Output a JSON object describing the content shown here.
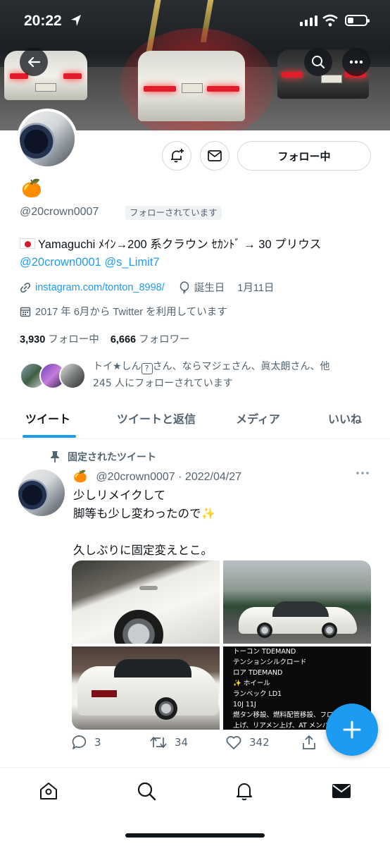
{
  "status_bar": {
    "time": "20:22"
  },
  "profile": {
    "name_emoji": "🍊",
    "handle": "@20crown0007",
    "follows_you_label": "フォローされています",
    "follow_button_label": "フォロー中",
    "bio_line1": "Yamaguchi ﾒｲﾝ→200 系クラウン ｾｶﾝﾄﾞ → 30 プリウス",
    "bio_mention1": "@20crown0001",
    "bio_mention2": "@s_Limit7",
    "website": "instagram.com/tonton_8998/",
    "birthday_label": "誕生日",
    "birthday": "1月11日",
    "joined": "2017 年 6月から Twitter を利用しています",
    "following_count": "3,930",
    "following_label": "フォロー中",
    "followers_count": "6,666",
    "followers_label": "フォロワー",
    "mutual_text_a": "トイ★しん",
    "mutual_text_b": "さん、ならマジェさん、眞太朗さん、他",
    "mutual_text_c": "245 人にフォローされています"
  },
  "tabs": [
    {
      "label": "ツイート"
    },
    {
      "label": "ツイートと返信"
    },
    {
      "label": "メディア"
    },
    {
      "label": "いいね"
    }
  ],
  "tweet": {
    "pinned_label": "固定されたツイート",
    "emoji": "🍊",
    "handle": "@20crown0007",
    "separator": "·",
    "date": "2022/04/27",
    "text": "少しリメイクして\n脚等も少し変わったので✨\n\n久しぶりに固定変えとこ。",
    "image4_text": "トーコン TDEMAND\nテンションシルクロード\nロア TDEMAND\n✨ ホイール\nランベック LD1\n10J 11J\n燃タン移設、燃料配管移設、フロントメンバー\n上げ、リアメン上げ、AT メンバー上げ\n強化フェンダー",
    "reply_count": "3",
    "retweet_count": "34",
    "like_count": "342"
  },
  "colors": {
    "accent": "#1d9bf0",
    "text_primary": "#0f1419",
    "text_secondary": "#536471"
  },
  "icons": [
    "back-arrow-icon",
    "search-icon",
    "more-icon",
    "bell-plus-icon",
    "mail-icon",
    "link-icon",
    "balloon-icon",
    "calendar-icon",
    "pin-icon",
    "reply-icon",
    "retweet-icon",
    "like-icon",
    "share-icon",
    "compose-icon",
    "home-icon",
    "notifications-icon",
    "messages-icon"
  ]
}
